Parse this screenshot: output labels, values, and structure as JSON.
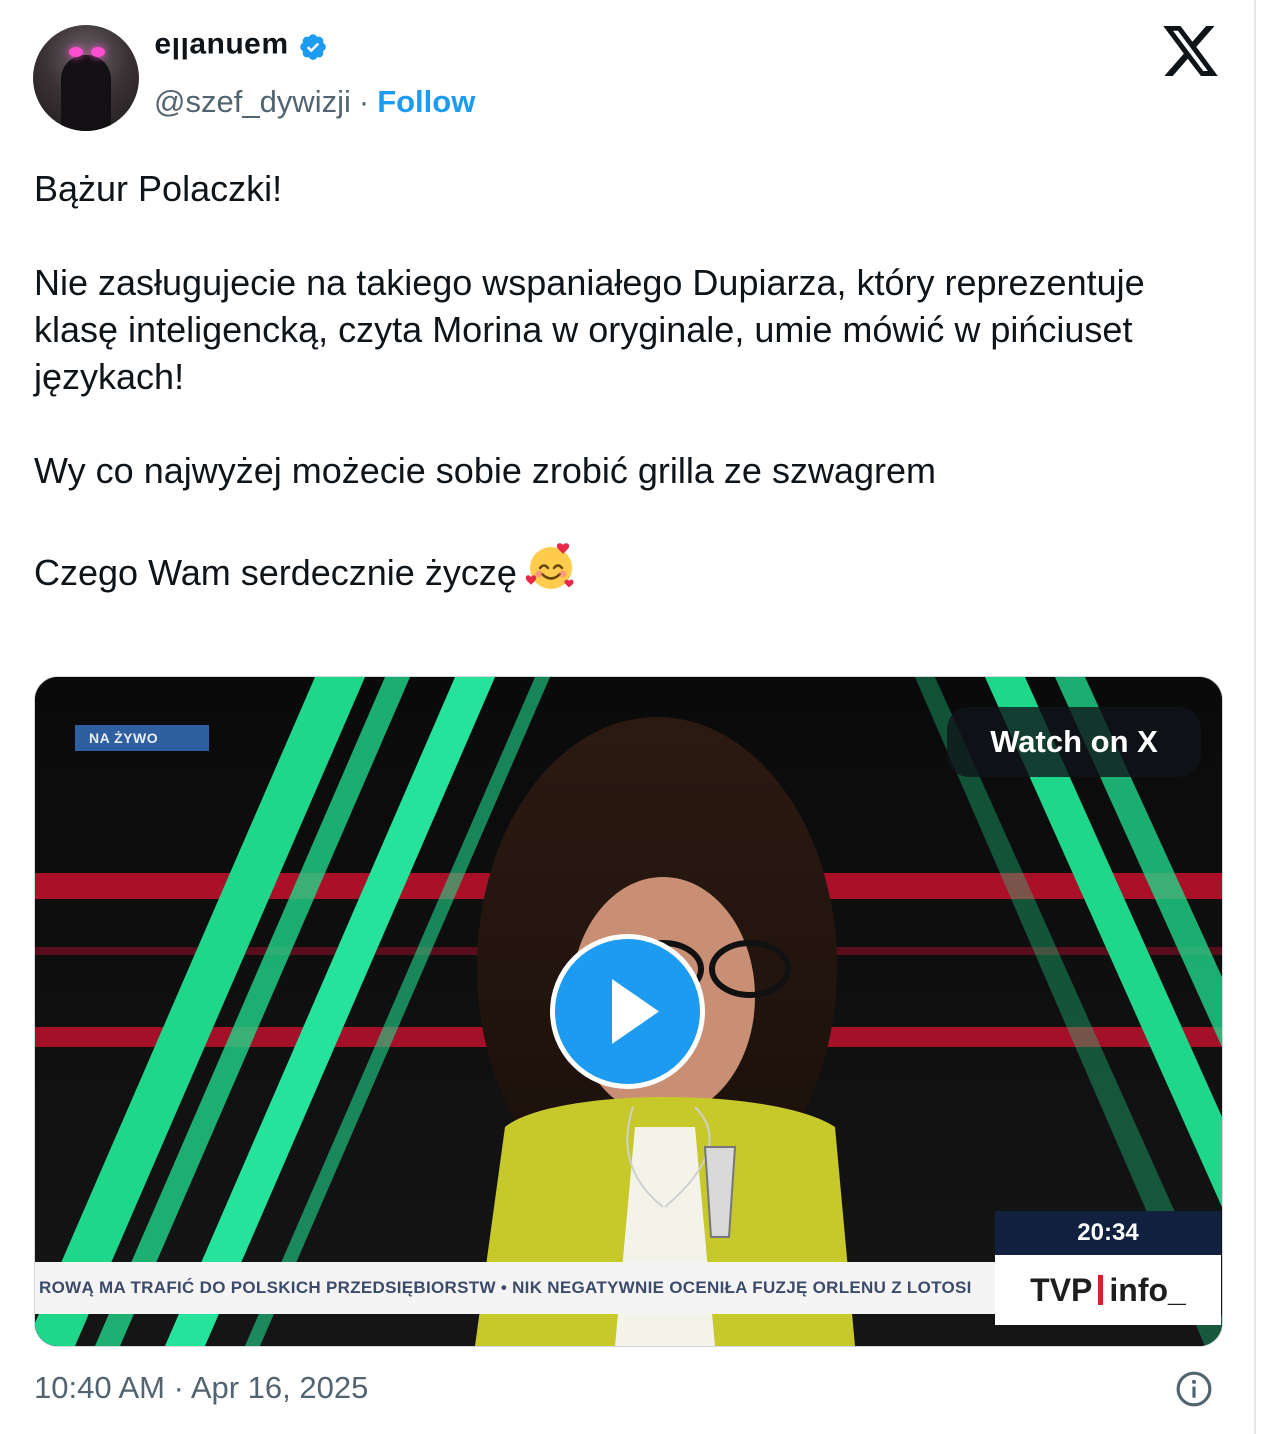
{
  "author": {
    "display_name": "ɯǝnuɐllǝ",
    "handle": "@szef_dywizji",
    "separator": "·",
    "follow_label": "Follow",
    "verified": true
  },
  "tweet": {
    "paragraphs": [
      "Bążur Polaczki!",
      "Nie zasługujecie na takiego wspaniałego Dupiarza, który reprezentuje klasę inteligencką, czyta Morina w oryginale, umie mówić w pińciuset językach!",
      "Wy co najwyżej możecie sobie zrobić grilla ze szwagrem",
      "Czego Wam serdecznie życzę"
    ],
    "emoji": "smiling-face-with-hearts"
  },
  "video": {
    "live_badge": "NA ŻYWO",
    "watch_label": "Watch on X",
    "clock": "20:34",
    "channel_main": "TVP",
    "channel_suffix": "info_",
    "ticker": "ROWĄ MA TRAFIĆ DO POLSKICH PRZEDSIĘBIORSTW • NIK NEGATYWNIE OCENIŁA FUZJĘ ORLENU Z LOTOSI"
  },
  "timestamp": "10:40 AM · Apr 16, 2025",
  "colors": {
    "accent": "#1d9bf0",
    "text": "#0f1419",
    "muted": "#536471"
  }
}
